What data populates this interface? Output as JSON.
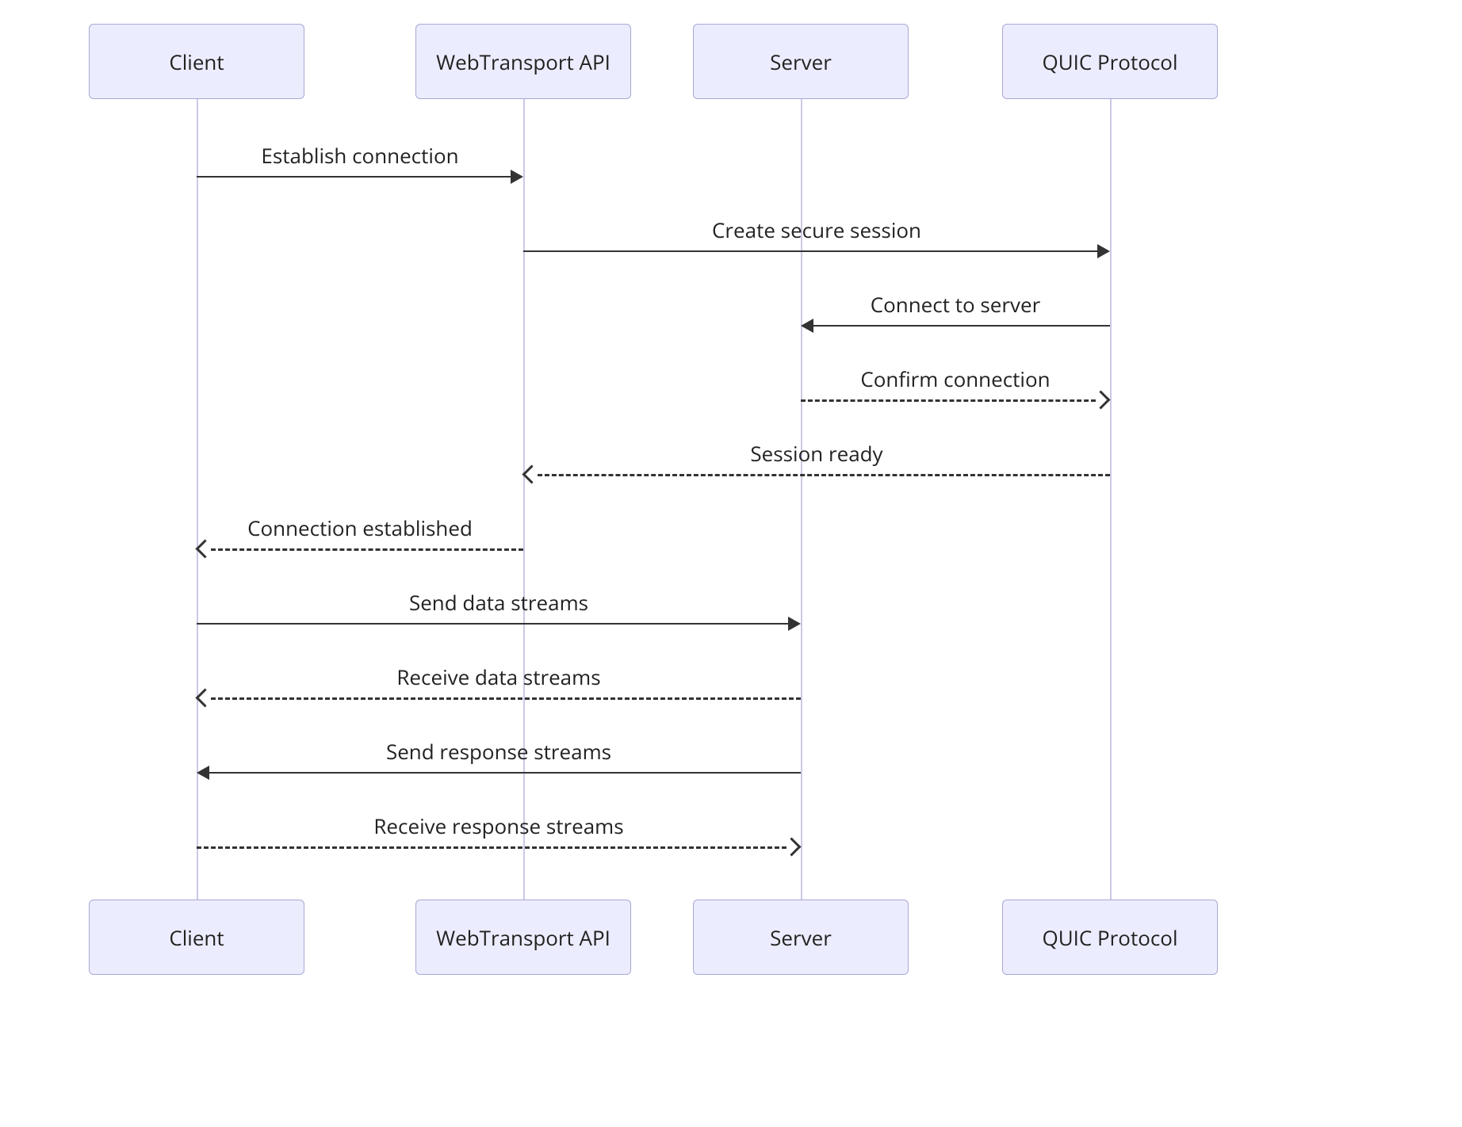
{
  "actors": {
    "client": "Client",
    "api": "WebTransport API",
    "server": "Server",
    "quic": "QUIC Protocol"
  },
  "messages": {
    "m1": "Establish connection",
    "m2": "Create secure session",
    "m3": "Connect to server",
    "m4": "Confirm connection",
    "m5": "Session ready",
    "m6": "Connection established",
    "m7": "Send data streams",
    "m8": "Receive data streams",
    "m9": "Send response streams",
    "m10": "Receive response streams"
  },
  "colors": {
    "box_fill": "#ECECFF",
    "box_border": "#A9A9D4",
    "line": "#333333",
    "lifeline": "#C9C9E6"
  }
}
